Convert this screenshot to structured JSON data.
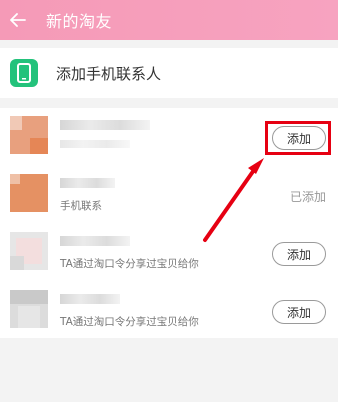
{
  "header": {
    "title": "新的淘友"
  },
  "add_contacts": {
    "label": "添加手机联系人"
  },
  "items": [
    {
      "subtitle": "",
      "action": "添加",
      "status": "button"
    },
    {
      "subtitle": "手机联系",
      "action": "已添加",
      "status": "added"
    },
    {
      "subtitle": "TA通过淘口令分享过宝贝给你",
      "action": "添加",
      "status": "button"
    },
    {
      "subtitle": "TA通过淘口令分享过宝贝给你",
      "action": "添加",
      "status": "button"
    }
  ],
  "colors": {
    "accent": "#f59ab7",
    "annotation": "#e60012",
    "phone_icon": "#23c27b"
  }
}
